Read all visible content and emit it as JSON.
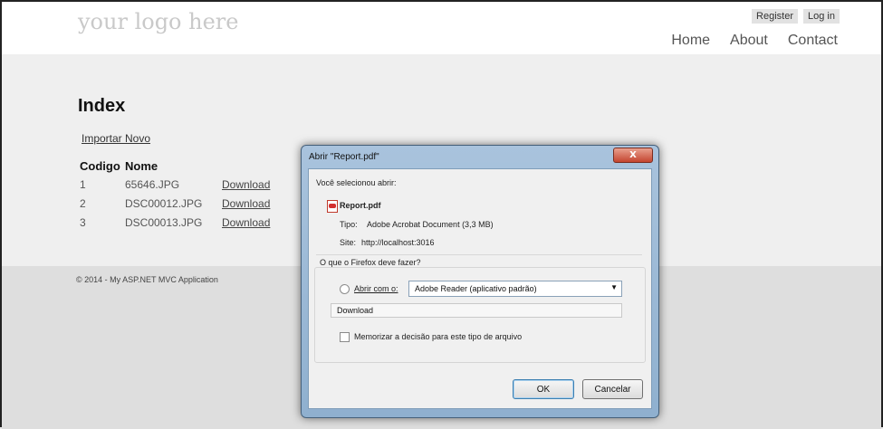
{
  "header": {
    "logo": "your logo here",
    "register": "Register",
    "login": "Log in",
    "nav": [
      "Home",
      "About",
      "Contact"
    ]
  },
  "page": {
    "title": "Index",
    "import_link": "Importar Novo",
    "table": {
      "headers": [
        "Codigo",
        "Nome"
      ],
      "rows": [
        {
          "codigo": "1",
          "nome": "65646.JPG",
          "action": "Download"
        },
        {
          "codigo": "2",
          "nome": "DSC00012.JPG",
          "action": "Download"
        },
        {
          "codigo": "3",
          "nome": "DSC00013.JPG",
          "action": "Download"
        }
      ]
    }
  },
  "footer": {
    "text": "© 2014 - My ASP.NET MVC Application"
  },
  "dialog": {
    "title": "Abrir \"Report.pdf\"",
    "selected_label": "Você selecionou abrir:",
    "filename": "Report.pdf",
    "type_label": "Tipo:",
    "type_value": "Adobe Acrobat Document (3,3 MB)",
    "site_label": "Site:",
    "site_value": "http://localhost:3016",
    "question": "O que o Firefox deve fazer?",
    "open_with_label": "Abrir com o:",
    "open_with_value": "Adobe Reader  (aplicativo padrão)",
    "download_label": "Download",
    "remember_label": "Memorizar a decisão para este tipo de arquivo",
    "ok": "OK",
    "cancel": "Cancelar",
    "close": "X"
  }
}
